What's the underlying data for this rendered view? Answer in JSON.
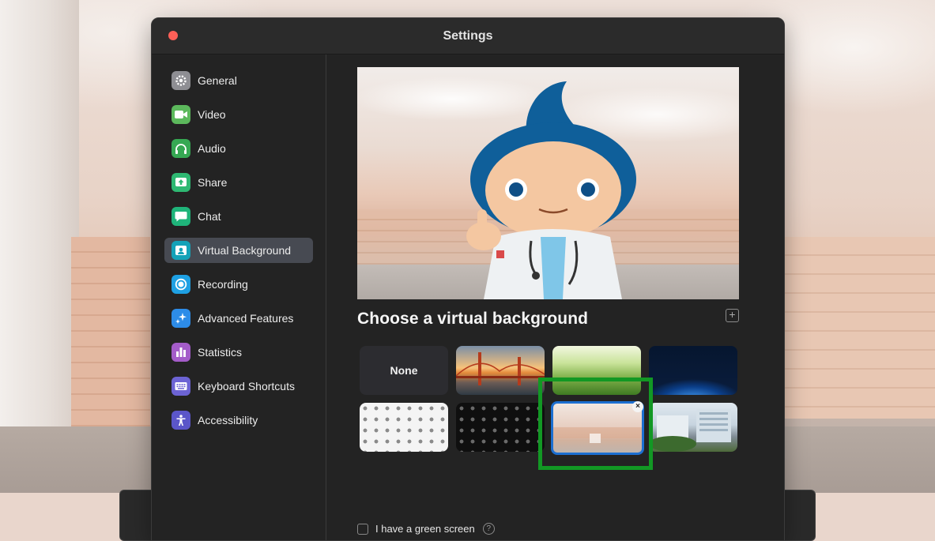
{
  "window": {
    "title": "Settings"
  },
  "sidebar": {
    "items": [
      {
        "label": "General",
        "icon": "gear-icon",
        "color": "#8e8e93",
        "active": false
      },
      {
        "label": "Video",
        "icon": "video-camera-icon",
        "color": "#5cb85c",
        "active": false
      },
      {
        "label": "Audio",
        "icon": "headphones-icon",
        "color": "#36a853",
        "active": false
      },
      {
        "label": "Share",
        "icon": "share-screen-icon",
        "color": "#2eb872",
        "active": false
      },
      {
        "label": "Chat",
        "icon": "chat-bubble-icon",
        "color": "#1fb47a",
        "active": false
      },
      {
        "label": "Virtual Background",
        "icon": "virtual-background-icon",
        "color": "#14a2b8",
        "active": true
      },
      {
        "label": "Recording",
        "icon": "record-icon",
        "color": "#1ea0e3",
        "active": false
      },
      {
        "label": "Advanced Features",
        "icon": "sparkle-icon",
        "color": "#2d8ce8",
        "active": false
      },
      {
        "label": "Statistics",
        "icon": "bar-chart-icon",
        "color": "#a45cc9",
        "active": false
      },
      {
        "label": "Keyboard Shortcuts",
        "icon": "keyboard-icon",
        "color": "#6c63d4",
        "active": false
      },
      {
        "label": "Accessibility",
        "icon": "accessibility-icon",
        "color": "#5b56c9",
        "active": false
      }
    ]
  },
  "virtual_background": {
    "title": "Choose a virtual background",
    "add_icon": "plus-icon",
    "thumbnails": [
      {
        "label": "None"
      },
      {
        "label": ""
      },
      {
        "label": ""
      },
      {
        "label": ""
      },
      {
        "label": ""
      },
      {
        "label": ""
      },
      {
        "label": "",
        "selected": true
      },
      {
        "label": ""
      }
    ],
    "remove_icon": "close-icon",
    "green_screen_label": "I have a green screen",
    "green_screen_checked": false,
    "help_icon": "question-icon"
  },
  "colors": {
    "accent": "#1c6fd1",
    "highlight": "#129824",
    "window_bg": "#232323",
    "active_item_bg": "#474a52"
  }
}
